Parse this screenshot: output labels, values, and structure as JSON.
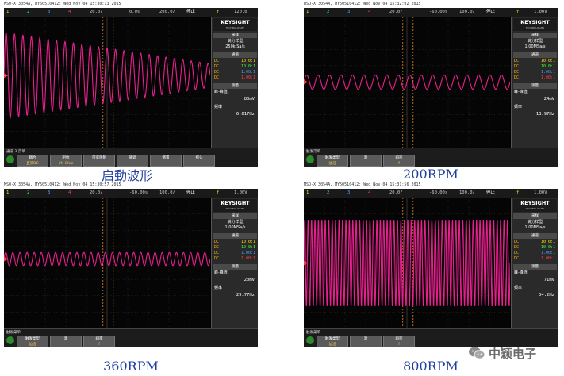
{
  "panels": [
    {
      "id": "p1",
      "topbar": {
        "title": "MSO-X 3054A, MY50510412: Wed Nov 04 15:30:13 2015",
        "channels": [
          "1",
          "2",
          "3",
          "4"
        ],
        "voltage": "20.0/",
        "time_pos": "0.0s",
        "timebase": "200.0/",
        "state": "停止",
        "trig_marker": "f",
        "trig_level": "120.0"
      },
      "trace": {
        "color": "#e8208f",
        "cycles": 24.5,
        "amp_start": 0.33,
        "amp_end": 0.09,
        "center": 0.45
      },
      "brand": {
        "name": "KEYSIGHT",
        "sub": "TECHNOLOGIES"
      },
      "acq": {
        "header": "采样",
        "label": "满分样型",
        "rate": "250k Sa/s"
      },
      "chan": {
        "header": "通道",
        "rows": [
          {
            "coupling": "DC",
            "value": "10.0:1",
            "color": "#ffe000"
          },
          {
            "coupling": "DC",
            "value": "10.0:1",
            "color": "#3cff3c"
          },
          {
            "coupling": "DC",
            "value": "1.00:1",
            "color": "#4aa0ff"
          },
          {
            "coupling": "DC",
            "value": "1.00:1",
            "color": "#ff4040"
          }
        ]
      },
      "meas": {
        "header": "测量",
        "vpp_label": "峰-峰值",
        "vpp": "80mV",
        "freq_label": "频率",
        "freq": "6.617Hz"
      },
      "softkeys": {
        "menu": "通道 3 菜单",
        "keys": [
          {
            "label": "耦合",
            "value": "直流DC"
          },
          {
            "label": "阻抗",
            "value": "1M Ohm"
          },
          {
            "label": "带宽限制",
            "value": ""
          },
          {
            "label": "微调",
            "value": ""
          },
          {
            "label": "倒置",
            "value": ""
          },
          {
            "label": "探头",
            "value": ""
          }
        ]
      },
      "caption": "启動波形"
    },
    {
      "id": "p2",
      "topbar": {
        "title": "MSO-X 3054A, MY50510412: Wed Nov 04 15:32:02 2015",
        "channels": [
          "1",
          "2",
          "3",
          "4"
        ],
        "voltage": "20.0/",
        "time_pos": "-60.00s",
        "timebase": "100.0/",
        "state": "停止",
        "trig_marker": "f",
        "trig_level": "1.00V"
      },
      "trace": {
        "color": "#e8208f",
        "cycles": 18,
        "amp_start": 0.055,
        "amp_end": 0.055,
        "center": 0.5
      },
      "brand": {
        "name": "KEYSIGHT",
        "sub": "TECHNOLOGIES"
      },
      "acq": {
        "header": "采样",
        "label": "满分样型",
        "rate": "1.00MSa/s"
      },
      "chan": {
        "header": "通道",
        "rows": [
          {
            "coupling": "DC",
            "value": "10.0:1",
            "color": "#ffe000"
          },
          {
            "coupling": "DC",
            "value": "10.0:1",
            "color": "#3cff3c"
          },
          {
            "coupling": "DC",
            "value": "1.00:1",
            "color": "#4aa0ff"
          },
          {
            "coupling": "DC",
            "value": "1.00:1",
            "color": "#ff4040"
          }
        ]
      },
      "meas": {
        "header": "测量",
        "vpp_label": "峰-峰值",
        "vpp": "24mV",
        "freq_label": "频率",
        "freq": "13.97Hz"
      },
      "softkeys": {
        "menu": "触发菜单",
        "keys": [
          {
            "label": "触发类型",
            "value": "边沿"
          },
          {
            "label": "源",
            "value": ""
          },
          {
            "label": "斜率",
            "value": "f"
          }
        ]
      },
      "caption": "200RPM"
    },
    {
      "id": "p3",
      "topbar": {
        "title": "MSO-X 3054A, MY50510412: Wed Nov 04 15:30:57 2015",
        "channels": [
          "1",
          "2",
          "3",
          "4"
        ],
        "voltage": "20.0/",
        "time_pos": "-60.00s",
        "timebase": "100.0/",
        "state": "停止",
        "trig_marker": "f",
        "trig_level": "1.00V"
      },
      "trace": {
        "color": "#e8208f",
        "cycles": 29,
        "amp_start": 0.05,
        "amp_end": 0.05,
        "center": 0.47
      },
      "brand": {
        "name": "KEYSIGHT",
        "sub": "TECHNOLOGIES"
      },
      "acq": {
        "header": "采样",
        "label": "满分样型",
        "rate": "1.00MSa/s"
      },
      "chan": {
        "header": "通道",
        "rows": [
          {
            "coupling": "DC",
            "value": "10.0:1",
            "color": "#ffe000"
          },
          {
            "coupling": "DC",
            "value": "10.0:1",
            "color": "#3cff3c"
          },
          {
            "coupling": "DC",
            "value": "1.00:1",
            "color": "#4aa0ff"
          },
          {
            "coupling": "DC",
            "value": "1.00:1",
            "color": "#ff4040"
          }
        ]
      },
      "meas": {
        "header": "测量",
        "vpp_label": "峰-峰值",
        "vpp": "20mV",
        "freq_label": "频率",
        "freq": "29.77Hz"
      },
      "softkeys": {
        "menu": "触发菜单",
        "keys": [
          {
            "label": "触发类型",
            "value": "边沿"
          },
          {
            "label": "源",
            "value": ""
          },
          {
            "label": "斜率",
            "value": "f"
          }
        ]
      },
      "caption": "360RPM"
    },
    {
      "id": "p4",
      "topbar": {
        "title": "MSO-X 3054A, MY50510412: Wed Nov 04 15:31:56 2015",
        "channels": [
          "1",
          "2",
          "3",
          "4"
        ],
        "voltage": "20.0/",
        "time_pos": "-60.00s",
        "timebase": "100.0/",
        "state": "停止",
        "trig_marker": "f",
        "trig_level": "1.00V"
      },
      "trace": {
        "color": "#e8208f",
        "cycles": 60,
        "amp_start": 0.33,
        "amp_end": 0.33,
        "center": 0.5
      },
      "brand": {
        "name": "KEYSIGHT",
        "sub": "TECHNOLOGIES"
      },
      "acq": {
        "header": "采样",
        "label": "满分样型",
        "rate": "1.00MSa/s"
      },
      "chan": {
        "header": "通道",
        "rows": [
          {
            "coupling": "DC",
            "value": "10.0:1",
            "color": "#ffe000"
          },
          {
            "coupling": "DC",
            "value": "10.0:1",
            "color": "#3cff3c"
          },
          {
            "coupling": "DC",
            "value": "1.00:1",
            "color": "#4aa0ff"
          },
          {
            "coupling": "DC",
            "value": "1.00:1",
            "color": "#ff4040"
          }
        ]
      },
      "meas": {
        "header": "测量",
        "vpp_label": "峰-峰值",
        "vpp": "71mV",
        "freq_label": "频率",
        "freq": "54.2Hz"
      },
      "softkeys": {
        "menu": "触发菜单",
        "keys": [
          {
            "label": "触发类型",
            "value": "边沿"
          },
          {
            "label": "源",
            "value": ""
          },
          {
            "label": "斜率",
            "value": "f"
          }
        ]
      },
      "caption": "800RPM"
    }
  ],
  "watermark": {
    "text": "中颖电子",
    "icon": "wechat-icon"
  }
}
